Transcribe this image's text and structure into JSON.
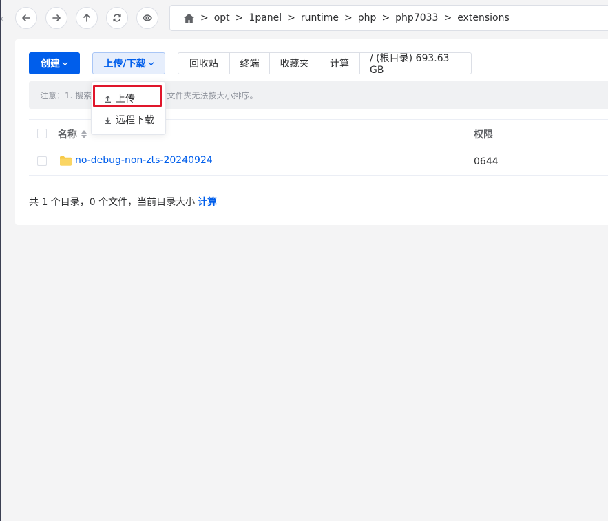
{
  "toolbar_nav": {
    "back_icon": "arrow-left-icon",
    "forward_icon": "arrow-right-icon",
    "up_icon": "arrow-up-icon",
    "refresh_icon": "refresh-icon",
    "view_icon": "eye-icon"
  },
  "breadcrumb": {
    "home_icon": "home-icon",
    "separator": ">",
    "items": [
      "opt",
      "1panel",
      "runtime",
      "php",
      "php7033",
      "extensions"
    ]
  },
  "actions": {
    "create_label": "创建",
    "upload_download_label": "上传/下载",
    "group": [
      "回收站",
      "终端",
      "收藏夹",
      "计算",
      "/ (根目录) 693.63 GB"
    ]
  },
  "dropdown": {
    "items": [
      "上传",
      "远程下载"
    ]
  },
  "notice": {
    "part1": "注意：1. 搜索",
    "part2": "2. 文件夹无法按大小排序。"
  },
  "table": {
    "headers": {
      "name": "名称",
      "permission": "权限"
    },
    "rows": [
      {
        "name": "no-debug-non-zts-20240924",
        "permission": "0644"
      }
    ]
  },
  "footer": {
    "summary": "共 1 个目录，0 个文件，当前目录大小",
    "calc_link": "计算"
  },
  "colors": {
    "primary": "#005eeb",
    "highlight": "#e0162b",
    "folder": "#f7c948"
  }
}
